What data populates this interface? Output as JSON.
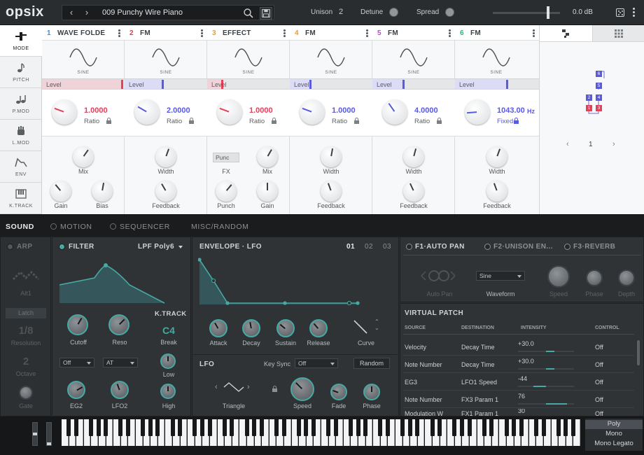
{
  "app": {
    "logo": "opsix"
  },
  "topbar": {
    "preset_name": "009 Punchy Wire Piano",
    "unison_label": "Unison",
    "unison_value": "2",
    "detune_label": "Detune",
    "spread_label": "Spread",
    "volume_value": "0.0 dB",
    "volume_level": 0.82
  },
  "sidebar": {
    "items": [
      {
        "label": "MODE"
      },
      {
        "label": "PITCH"
      },
      {
        "label": "P.MOD"
      },
      {
        "label": "L.MOD"
      },
      {
        "label": "ENV"
      },
      {
        "label": "K.TRACK"
      }
    ]
  },
  "operators": [
    {
      "num": "1",
      "name": "WAVE FOLDE",
      "color": "#3a8fd6",
      "wave": "SINE",
      "level_label": "Level",
      "level_color": "#e58ea0",
      "level": 0.98,
      "ratio_value": "1.0000",
      "ratio_label": "Ratio",
      "knobs": [
        "Mix",
        "Gain",
        "Bias"
      ]
    },
    {
      "num": "2",
      "name": "FM",
      "color": "#d4424f",
      "wave": "SINE",
      "level_label": "Level",
      "level_color": "#8e8ef0",
      "level": 0.46,
      "ratio_value": "2.0000",
      "ratio_label": "Ratio",
      "knobs": [
        "Width",
        "Feedback"
      ]
    },
    {
      "num": "3",
      "name": "EFFECT",
      "color": "#e0a032",
      "wave": "SINE",
      "level_label": "Level",
      "level_color": "#e58ea0",
      "level": 0.17,
      "ratio_value": "1.0000",
      "ratio_label": "Ratio",
      "fx_value": "Punc",
      "knobs": [
        "FX",
        "Mix",
        "Punch",
        "Gain"
      ]
    },
    {
      "num": "4",
      "name": "FM",
      "color": "#e0a032",
      "wave": "SINE",
      "level_label": "Level",
      "level_color": "#8e8ef0",
      "level": 0.24,
      "ratio_value": "1.0000",
      "ratio_label": "Ratio",
      "knobs": [
        "Width",
        "Feedback"
      ]
    },
    {
      "num": "5",
      "name": "FM",
      "color": "#b94fc9",
      "wave": "SINE",
      "level_label": "Level",
      "level_color": "#8e8ef0",
      "level": 0.37,
      "ratio_value": "4.0000",
      "ratio_label": "Ratio",
      "knobs": [
        "Width",
        "Feedback"
      ]
    },
    {
      "num": "6",
      "name": "FM",
      "color": "#2fb07b",
      "wave": "SINE",
      "level_label": "Level",
      "level_color": "#8e8ef0",
      "level": 0.62,
      "ratio_value": "1043.00",
      "ratio_unit": "Hz",
      "ratio_label": "Fixed",
      "knobs": [
        "Width",
        "Feedback"
      ]
    }
  ],
  "algorithm": {
    "page": "1",
    "boxes": [
      "6",
      "5",
      "2",
      "4",
      "1",
      "3"
    ]
  },
  "tabs": [
    {
      "label": "SOUND"
    },
    {
      "label": "MOTION"
    },
    {
      "label": "SEQUENCER"
    },
    {
      "label": "MISC/RANDOM"
    }
  ],
  "arp": {
    "title": "ARP",
    "type": "Alt1",
    "latch": "Latch",
    "resolution_value": "1/8",
    "resolution_label": "Resolution",
    "octave_value": "2",
    "octave_label": "Octave",
    "gate_label": "Gate"
  },
  "filter": {
    "title": "FILTER",
    "type": "LPF Poly6",
    "cutoff": "Cutoff",
    "reso": "Reso",
    "ktrack_title": "K.TRACK",
    "ktrack_value": "C4",
    "break_label": "Break",
    "low_label": "Low",
    "high_label": "High",
    "mod1_source": "Off",
    "mod2_source": "AT",
    "eg2": "EG2",
    "lfo2": "LFO2"
  },
  "envelope": {
    "title": "ENVELOPE · LFO",
    "tabs": [
      "01",
      "02",
      "03"
    ],
    "knobs": [
      "Attack",
      "Decay",
      "Sustain",
      "Release"
    ],
    "curve_label": "Curve"
  },
  "lfo": {
    "title": "LFO",
    "keysync_label": "Key Sync",
    "keysync_value": "Off",
    "random_label": "Random",
    "wave": "Triangle",
    "knobs": [
      "Speed",
      "Fade",
      "Phase"
    ]
  },
  "effects": {
    "tabs": [
      "F1·AUTO PAN",
      "F2·UNISON EN...",
      "F3·REVERB"
    ],
    "autopan_label": "Auto Pan",
    "waveform_value": "Sine",
    "waveform_label": "Waveform",
    "knobs": [
      "Speed",
      "Phase",
      "Depth"
    ]
  },
  "virtual_patch": {
    "title": "VIRTUAL PATCH",
    "columns": [
      "SOURCE",
      "DESTINATION",
      "INTENSITY",
      "CONTROL"
    ],
    "rows": [
      {
        "source": "Velocity",
        "destination": "Decay Time",
        "intensity": "+30.0",
        "control": "Off",
        "amount": 0.3
      },
      {
        "source": "Note Number",
        "destination": "Decay Time",
        "intensity": "+30.0",
        "control": "Off",
        "amount": 0.3
      },
      {
        "source": "EG3",
        "destination": "LFO1 Speed",
        "intensity": "-44",
        "control": "Off",
        "amount": 0.44
      },
      {
        "source": "Note Number",
        "destination": "FX3 Param 1",
        "intensity": "76",
        "control": "Off",
        "amount": 0.76
      },
      {
        "source": "Modulation W",
        "destination": "FX1 Param 1",
        "intensity": "30",
        "control": "Off",
        "amount": 0.3
      }
    ]
  },
  "voice_modes": [
    {
      "label": "Poly"
    },
    {
      "label": "Mono"
    },
    {
      "label": "Mono Legato"
    }
  ],
  "colors": {
    "accent": "#46a9a3",
    "pink": "#e0425a",
    "violet": "#5a5ae0"
  }
}
